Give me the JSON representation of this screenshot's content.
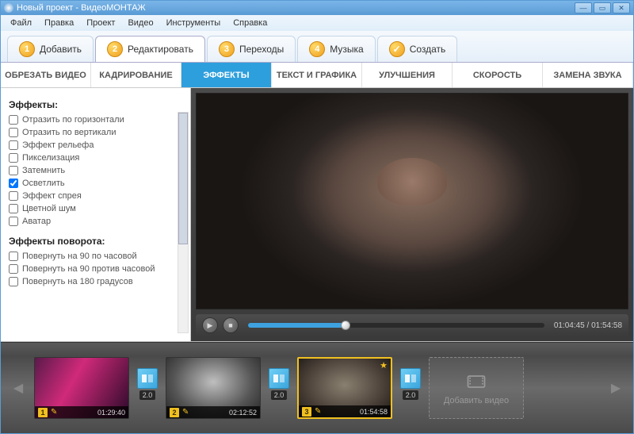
{
  "window": {
    "title": "Новый проект - ВидеоМОНТАЖ"
  },
  "menu": {
    "file": "Файл",
    "edit": "Правка",
    "project": "Проект",
    "video": "Видео",
    "tools": "Инструменты",
    "help": "Справка"
  },
  "steps": {
    "s1": {
      "num": "1",
      "label": "Добавить"
    },
    "s2": {
      "num": "2",
      "label": "Редактировать"
    },
    "s3": {
      "num": "3",
      "label": "Переходы"
    },
    "s4": {
      "num": "4",
      "label": "Музыка"
    },
    "s5": {
      "label": "Создать"
    }
  },
  "subtabs": {
    "crop": "ОБРЕЗАТЬ ВИДЕО",
    "frame": "КАДРИРОВАНИЕ",
    "effects": "ЭФФЕКТЫ",
    "text": "ТЕКСТ И ГРАФИКА",
    "enhance": "УЛУЧШЕНИЯ",
    "speed": "СКОРОСТЬ",
    "audio": "ЗАМЕНА ЗВУКА"
  },
  "effects": {
    "title": "Эффекты:",
    "items": [
      {
        "label": "Отразить по горизонтали",
        "checked": false
      },
      {
        "label": "Отразить по вертикали",
        "checked": false
      },
      {
        "label": "Эффект рельефа",
        "checked": false
      },
      {
        "label": "Пикселизация",
        "checked": false
      },
      {
        "label": "Затемнить",
        "checked": false
      },
      {
        "label": "Осветлить",
        "checked": true
      },
      {
        "label": "Эффект спрея",
        "checked": false
      },
      {
        "label": "Цветной шум",
        "checked": false
      },
      {
        "label": "Аватар",
        "checked": false
      }
    ],
    "rotation_title": "Эффекты поворота:",
    "rotation_items": [
      {
        "label": "Повернуть на 90 по часовой",
        "checked": false
      },
      {
        "label": "Повернуть на 90 против часовой",
        "checked": false
      },
      {
        "label": "Повернуть на 180 градусов",
        "checked": false
      }
    ]
  },
  "player": {
    "time": "01:04:45 / 01:54:58"
  },
  "timeline": {
    "clips": [
      {
        "idx": "1",
        "dur": "01:29:40",
        "star": false
      },
      {
        "idx": "2",
        "dur": "02:12:52",
        "star": false
      },
      {
        "idx": "3",
        "dur": "01:54:58",
        "star": true
      }
    ],
    "transitions": [
      {
        "dur": "2.0"
      },
      {
        "dur": "2.0"
      },
      {
        "dur": "2.0"
      }
    ],
    "add_label": "Добавить видео"
  }
}
